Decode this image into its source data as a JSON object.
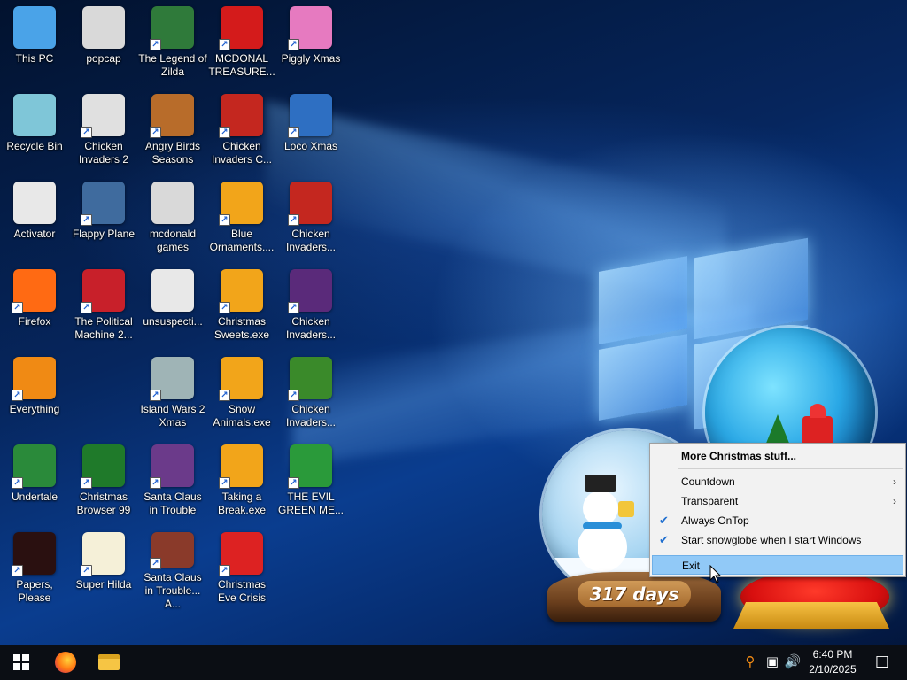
{
  "desktop": {
    "icons": [
      {
        "label": "This PC",
        "icon": "computer-icon",
        "color": "#4aa3e8"
      },
      {
        "label": "popcap",
        "icon": "folder-icon",
        "color": "#d9d9d9"
      },
      {
        "label": "The Legend of Zilda",
        "icon": "game-icon",
        "color": "#2f7a3a"
      },
      {
        "label": "MCDONAL TREASURE...",
        "icon": "mcdonalds-icon",
        "color": "#d41b1b"
      },
      {
        "label": "Piggly Xmas",
        "icon": "pig-icon",
        "color": "#e67ac0"
      },
      {
        "label": "Recycle Bin",
        "icon": "recycle-bin-icon",
        "color": "#7fc6d8"
      },
      {
        "label": "Chicken Invaders 2",
        "icon": "chicken-icon",
        "color": "#e0e0e0"
      },
      {
        "label": "Angry Birds Seasons",
        "icon": "angry-birds-icon",
        "color": "#b86c2a"
      },
      {
        "label": "Chicken Invaders C...",
        "icon": "chicken-icon",
        "color": "#c4271f"
      },
      {
        "label": "Loco Xmas",
        "icon": "bear-icon",
        "color": "#2e6fc2"
      },
      {
        "label": "Activator",
        "icon": "file-icon",
        "color": "#e8e8e8"
      },
      {
        "label": "Flappy Plane",
        "icon": "plane-icon",
        "color": "#3f6b9e"
      },
      {
        "label": "mcdonald games",
        "icon": "folder-icon",
        "color": "#d9d9d9"
      },
      {
        "label": "Blue Ornaments....",
        "icon": "puzzle-icon",
        "color": "#f2a51a"
      },
      {
        "label": "Chicken Invaders...",
        "icon": "chicken-icon",
        "color": "#c4271f"
      },
      {
        "label": "Firefox",
        "icon": "firefox-icon",
        "color": "#ff6a13"
      },
      {
        "label": "The Political Machine 2...",
        "icon": "political-icon",
        "color": "#c8202a"
      },
      {
        "label": "unsuspecti...",
        "icon": "file-icon",
        "color": "#e8e8e8"
      },
      {
        "label": "Christmas Sweets.exe",
        "icon": "puzzle-icon",
        "color": "#f2a51a"
      },
      {
        "label": "Chicken Invaders...",
        "icon": "chicken-icon",
        "color": "#5a2a7a"
      },
      {
        "label": "Everything",
        "icon": "search-magnifier-icon",
        "color": "#f08a14"
      },
      {
        "label": "Island Wars 2 Xmas",
        "icon": "island-icon",
        "color": "#9fb4b6"
      },
      {
        "label": "Snow Animals.exe",
        "icon": "puzzle-icon",
        "color": "#f2a51a"
      },
      {
        "label": "Chicken Invaders...",
        "icon": "chicken-icon",
        "color": "#3a8a2a"
      },
      {
        "label": "Undertale",
        "icon": "undertale-icon",
        "color": "#2a8a3a"
      },
      {
        "label": "Christmas Browser 99",
        "icon": "christmas-tree-icon",
        "color": "#1f7a2a"
      },
      {
        "label": "Santa Claus in Trouble",
        "icon": "santa-icon",
        "color": "#6b3a8a"
      },
      {
        "label": "Taking a Break.exe",
        "icon": "puzzle-icon",
        "color": "#f2a51a"
      },
      {
        "label": "THE EVIL GREEN ME...",
        "icon": "messenger-icon",
        "color": "#2a9a3a"
      },
      {
        "label": "Papers, Please",
        "icon": "papers-please-icon",
        "color": "#2a1010"
      },
      {
        "label": "Super Hilda",
        "icon": "pixel-icon",
        "color": "#f5f0d8"
      },
      {
        "label": "Santa Claus in Trouble... A...",
        "icon": "santa-icon",
        "color": "#8a3a2a"
      },
      {
        "label": "Christmas Eve Crisis",
        "icon": "santa-face-icon",
        "color": "#d22"
      }
    ]
  },
  "snowglobe": {
    "days_label": "317 days"
  },
  "context_menu": {
    "items": [
      {
        "label": "More Christmas stuff...",
        "bold": true,
        "checked": false,
        "submenu": false,
        "highlighted": false
      },
      {
        "label": "Countdown",
        "bold": false,
        "checked": false,
        "submenu": true,
        "highlighted": false
      },
      {
        "label": "Transparent",
        "bold": false,
        "checked": false,
        "submenu": true,
        "highlighted": false
      },
      {
        "label": "Always OnTop",
        "bold": false,
        "checked": true,
        "submenu": false,
        "highlighted": false
      },
      {
        "label": "Start snowglobe when I start Windows",
        "bold": false,
        "checked": true,
        "submenu": false,
        "highlighted": false
      },
      {
        "label": "Exit",
        "bold": false,
        "checked": false,
        "submenu": false,
        "highlighted": true
      }
    ],
    "check_glyph": "✔",
    "arrow_glyph": "›"
  },
  "taskbar": {
    "start_icon": "windows-start-icon",
    "pinned": [
      "firefox-icon",
      "file-explorer-icon"
    ],
    "tray": [
      "everything-search-icon",
      "network-icon",
      "volume-icon"
    ],
    "time": "6:40 PM",
    "date": "2/10/2025",
    "notification_icon": "action-center-icon"
  }
}
